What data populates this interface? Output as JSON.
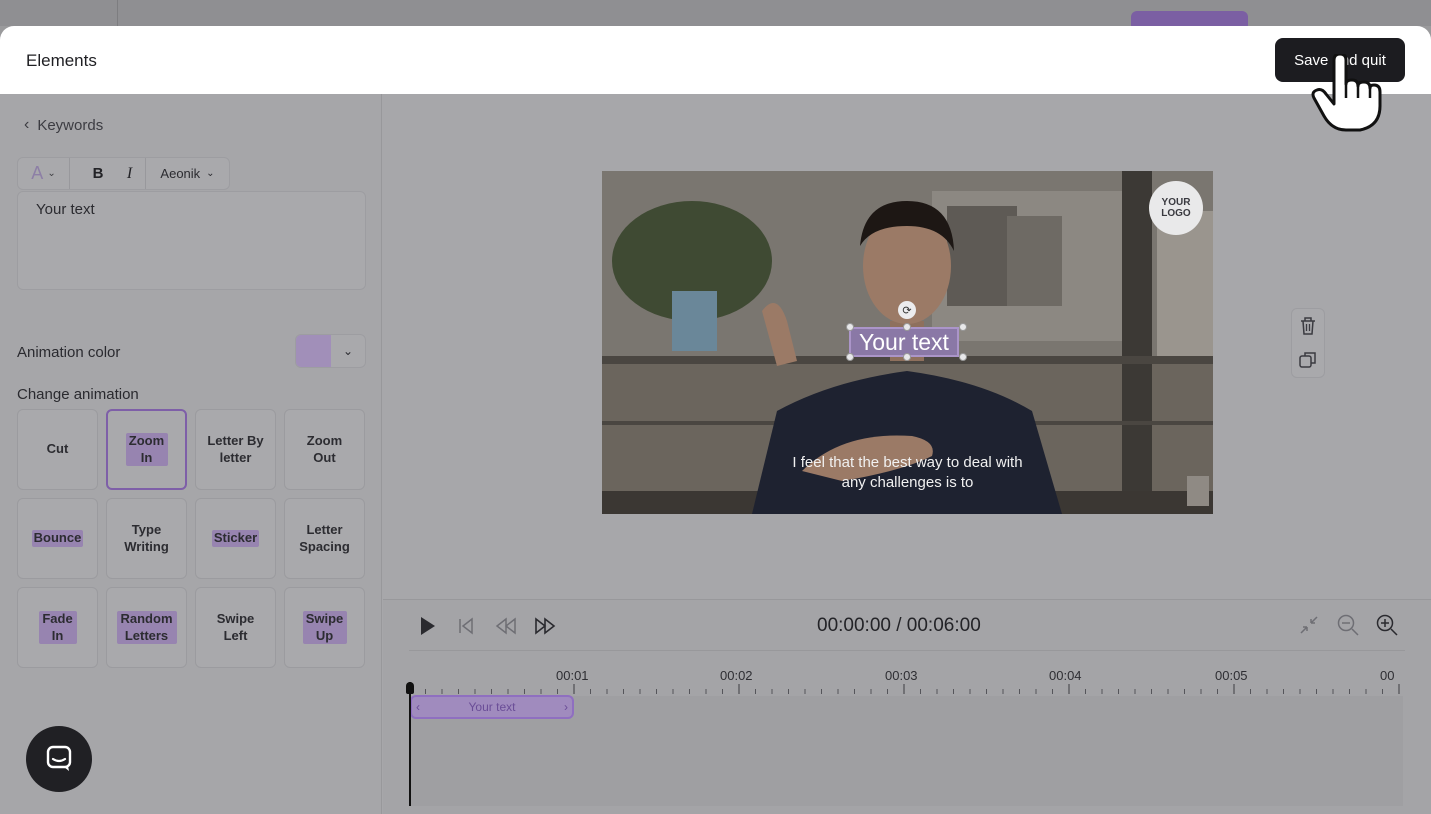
{
  "modal": {
    "title": "Elements",
    "save_label": "Save and quit"
  },
  "sidebar": {
    "back_label": "Keywords",
    "toolbar": {
      "color_icon": "A",
      "bold_label": "B",
      "italic_label": "I",
      "font_name": "Aeonik"
    },
    "text_value": "Your text",
    "animation_color_label": "Animation color",
    "animation_color": "#a18fb9",
    "change_animation_label": "Change animation",
    "animations": [
      {
        "label": "Cut"
      },
      {
        "label": "Zoom In",
        "selected": true
      },
      {
        "label": "Letter By letter"
      },
      {
        "label": "Zoom Out"
      },
      {
        "label": "Bounce"
      },
      {
        "label": "Type Writing"
      },
      {
        "label": "Sticker"
      },
      {
        "label": "Letter Spacing"
      },
      {
        "label": "Fade In"
      },
      {
        "label": "Random Letters"
      },
      {
        "label": "Swipe Left"
      },
      {
        "label": "Swipe Up"
      }
    ]
  },
  "stage": {
    "logo_text": "YOUR LOGO",
    "overlay_text": "Your text",
    "subtitle": "I feel that the best way to deal with any challenges is to"
  },
  "timeline": {
    "time_display": "00:00:00 / 00:06:00",
    "ruler": [
      "00:01",
      "00:02",
      "00:03",
      "00:04",
      "00:05",
      "00"
    ],
    "clip_label": "Your text"
  },
  "colors": {
    "accent": "#8f6fc0",
    "save_button": "#1c1c20"
  }
}
